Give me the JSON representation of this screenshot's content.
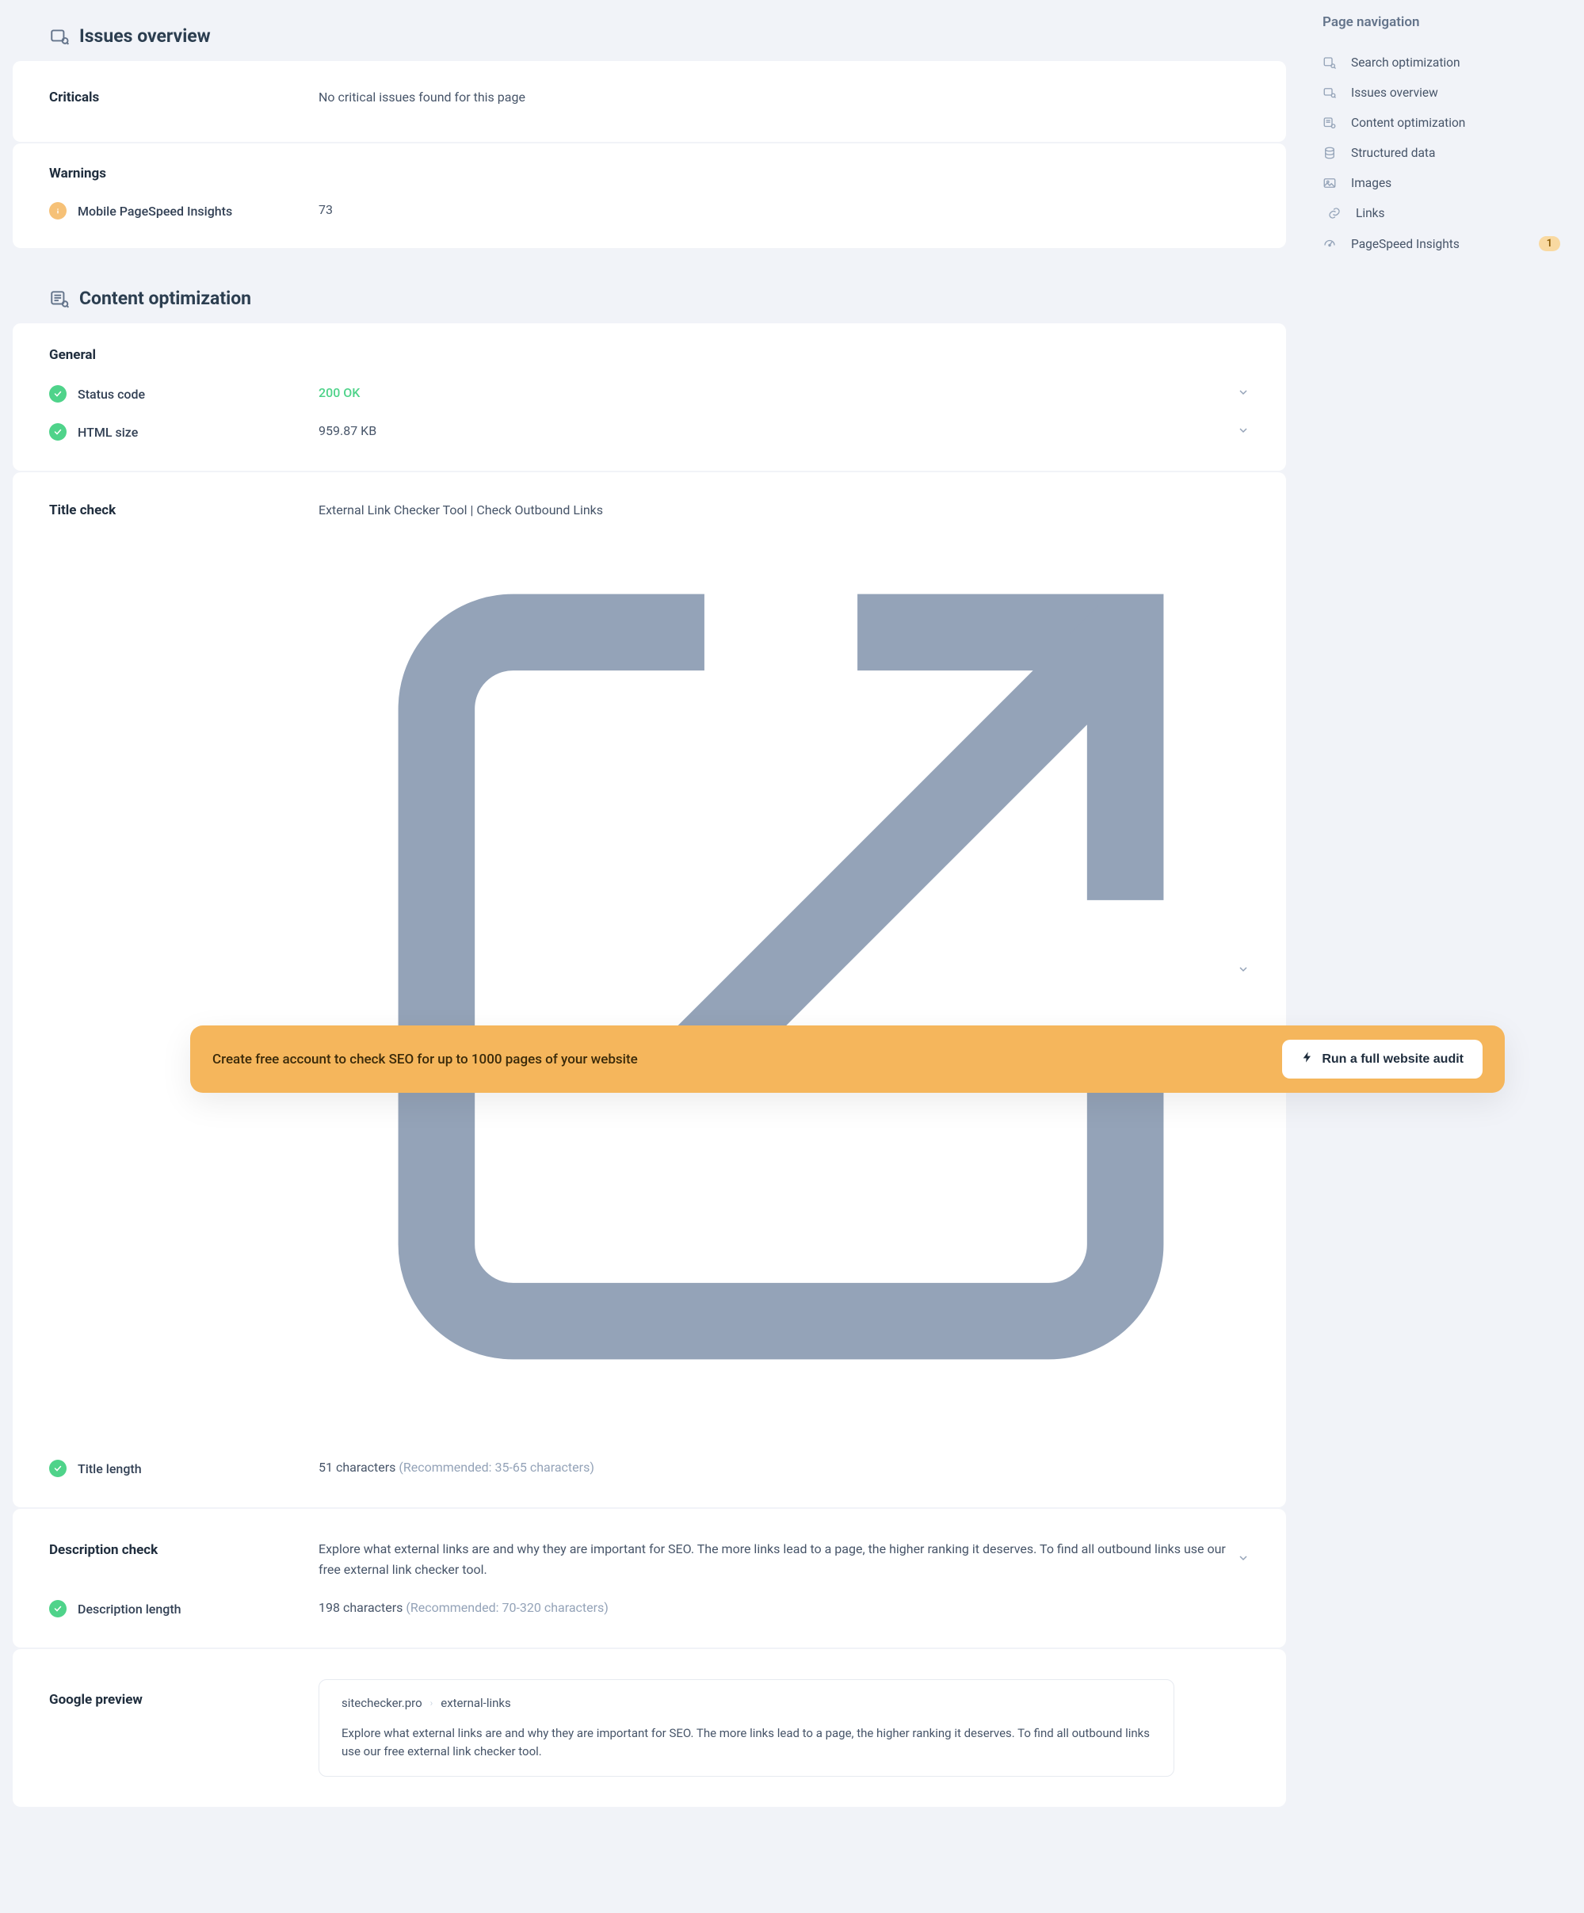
{
  "sections": {
    "issues": {
      "title": "Issues overview",
      "criticals": {
        "heading": "Criticals",
        "message": "No critical issues found for this page"
      },
      "warnings": {
        "heading": "Warnings",
        "items": [
          {
            "label": "Mobile PageSpeed Insights",
            "value": "73"
          }
        ]
      }
    },
    "content": {
      "title": "Content optimization",
      "general": {
        "heading": "General",
        "status_code_label": "Status code",
        "status_code_value": "200 OK",
        "html_size_label": "HTML size",
        "html_size_value": "959.87 KB"
      },
      "title_check": {
        "heading": "Title check",
        "title_text": "External Link Checker Tool | Check Outbound Links",
        "title_length_label": "Title length",
        "title_length_value": "51 characters",
        "title_length_rec": "(Recommended: 35-65 characters)"
      },
      "description_check": {
        "heading": "Description check",
        "desc_text": "Explore what external links are and why they are important for SEO. The more links lead to a page, the higher ranking it deserves. To find all outbound links use our free external link checker tool.",
        "desc_length_label": "Description length",
        "desc_length_value": "198 characters",
        "desc_length_rec": "(Recommended: 70-320 characters)"
      },
      "google_preview": {
        "heading": "Google preview",
        "domain": "sitechecker.pro",
        "path": "external-links",
        "desc": "Explore what external links are and why they are important for SEO. The more links lead to a page, the higher ranking it deserves. To find all outbound links use our free external link checker tool."
      }
    }
  },
  "nav": {
    "title": "Page navigation",
    "items": [
      {
        "id": "search-optimization",
        "label": "Search optimization",
        "icon": "search",
        "badge": null
      },
      {
        "id": "issues-overview",
        "label": "Issues overview",
        "icon": "issues",
        "badge": null
      },
      {
        "id": "content-optimization",
        "label": "Content optimization",
        "icon": "content",
        "badge": null
      },
      {
        "id": "structured-data",
        "label": "Structured data",
        "icon": "structured",
        "badge": null
      },
      {
        "id": "images",
        "label": "Images",
        "icon": "images",
        "badge": null
      },
      {
        "id": "links",
        "label": "Links",
        "icon": "links",
        "badge": null
      },
      {
        "id": "pagespeed-insights",
        "label": "PageSpeed Insights",
        "icon": "speed",
        "badge": "1"
      }
    ]
  },
  "cta": {
    "text": "Create free account to check SEO for up to 1000 pages of your website",
    "button": "Run a full website audit"
  }
}
